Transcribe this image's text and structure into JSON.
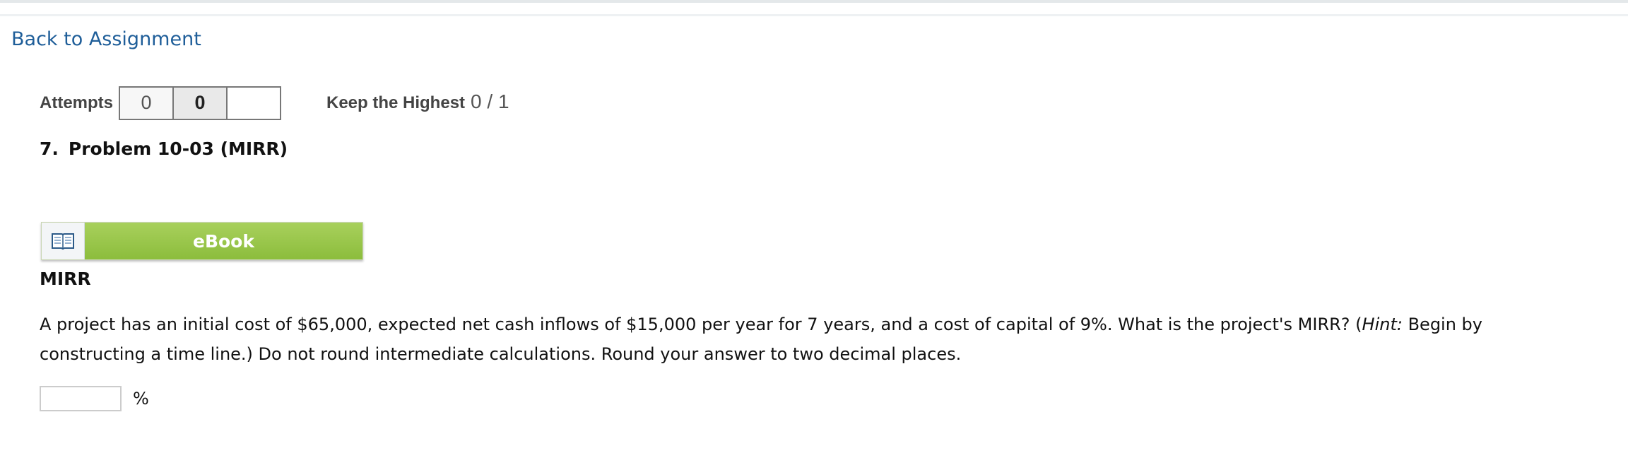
{
  "nav": {
    "back_label": "Back to Assignment"
  },
  "attempts": {
    "label": "Attempts",
    "values": [
      "0",
      "0",
      ""
    ]
  },
  "scoring": {
    "label": "Keep the Highest",
    "score": "0 / 1"
  },
  "problem": {
    "number": "7.",
    "title": "Problem 10-03 (MIRR)"
  },
  "ebook": {
    "icon": "open-book-icon",
    "label": "eBook"
  },
  "section": {
    "heading": "MIRR"
  },
  "question": {
    "text_before_hint": "A project has an initial cost of $65,000, expected net cash inflows of $15,000 per year for 7 years, and a cost of capital of 9%. What is the project's MIRR? (",
    "hint_label": "Hint:",
    "text_after_hint": " Begin by constructing a time line.) Do not round intermediate calculations. Round your answer to two decimal places."
  },
  "answer": {
    "value": "",
    "unit": "%"
  },
  "colors": {
    "link": "#1f5e99",
    "ebook_green": "#8cbd3c"
  }
}
